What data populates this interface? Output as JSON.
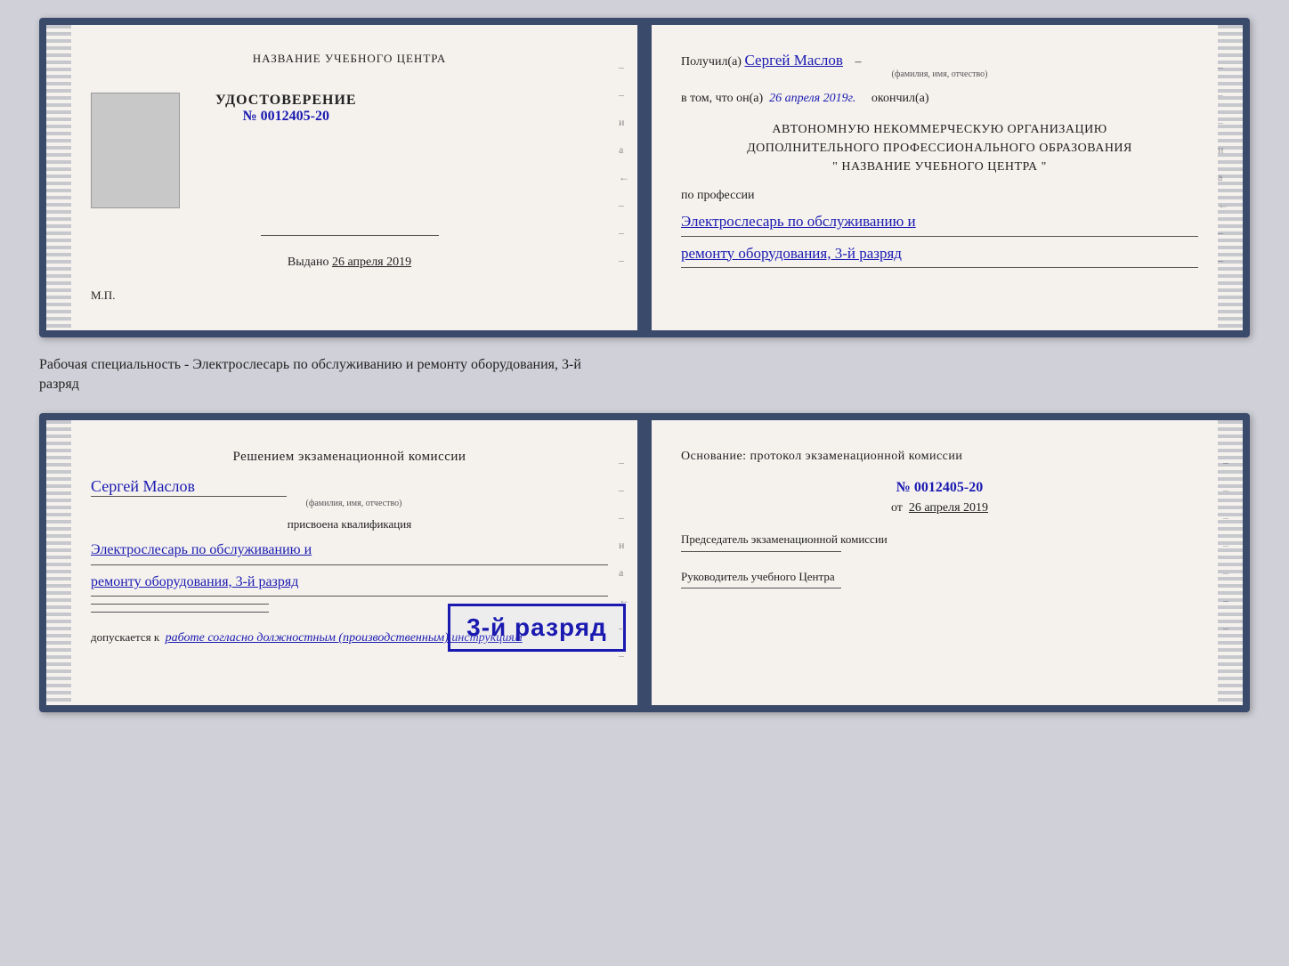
{
  "top_book": {
    "left_page": {
      "title": "НАЗВАНИЕ УЧЕБНОГО ЦЕНТРА",
      "udostoverenie_label": "УДОСТОВЕРЕНИЕ",
      "number": "№ 0012405-20",
      "vydano_label": "Выдано",
      "vydano_date": "26 апреля 2019",
      "mp_label": "М.П."
    },
    "right_page": {
      "poluchil_prefix": "Получил(а)",
      "recipient_name": "Сергей Маслов",
      "fio_caption": "(фамилия, имя, отчество)",
      "vtom_prefix": "в том, что он(а)",
      "vtom_date": "26 апреля 2019г.",
      "okonchil": "окончил(а)",
      "org_line1": "АВТОНОМНУЮ НЕКОММЕРЧЕСКУЮ ОРГАНИЗАЦИЮ",
      "org_line2": "ДОПОЛНИТЕЛЬНОГО ПРОФЕССИОНАЛЬНОГО ОБРАЗОВАНИЯ",
      "org_quotes_open": "\"",
      "org_name": "НАЗВАНИЕ УЧЕБНОГО ЦЕНТРА",
      "org_quotes_close": "\"",
      "po_professii": "по профессии",
      "profession_line1": "Электрослесарь по обслуживанию и",
      "profession_line2": "ремонту оборудования, 3-й разряд"
    }
  },
  "label_between": {
    "text": "Рабочая специальность - Электрослесарь по обслуживанию и ремонту оборудования, 3-й",
    "text2": "разряд"
  },
  "bottom_book": {
    "left_page": {
      "resheniem": "Решением экзаменационной комиссии",
      "name_handwritten": "Сергей Маслов",
      "fio_caption": "(фамилия, имя, отчество)",
      "prisvoena": "присвоена квалификация",
      "kvalif_line1": "Электрослесарь по обслуживанию и",
      "kvalif_line2": "ремонту оборудования, 3-й разряд",
      "dopuskaetsya": "допускается к",
      "dopusk_text": "работе согласно должностным (производственным) инструкциям"
    },
    "stamp": {
      "label": "3-й разряд"
    },
    "right_page": {
      "osnov_title": "Основание: протокол экзаменационной комиссии",
      "protocol_num": "№ 0012405-20",
      "from_label": "от",
      "from_date": "26 апреля 2019",
      "chairman_role": "Председатель экзаменационной комиссии",
      "rukov_role": "Руководитель учебного Центра"
    }
  },
  "side_letters": {
    "right1": "и",
    "right2": "а",
    "right3": "←"
  }
}
